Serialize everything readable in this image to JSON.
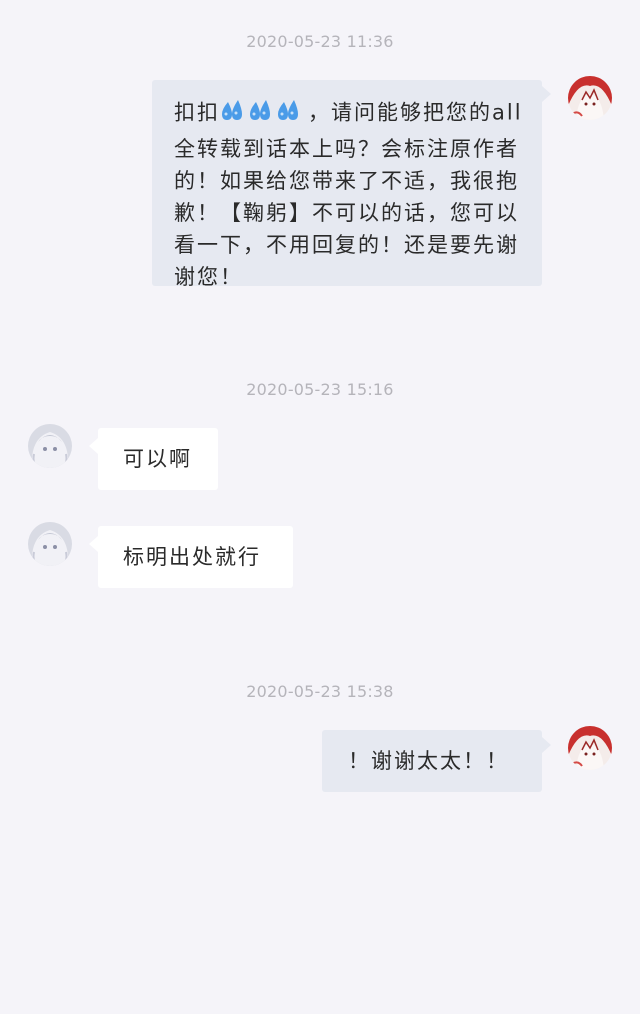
{
  "messages": [
    {
      "timestamp": "2020-05-23  11:36",
      "direction": "out",
      "text_before": "扣扣",
      "emoji": "sweat-drops",
      "text_after": "，请问能够把您的all全转载到话本上吗？会标注原作者的！如果给您带来了不适，我很抱歉！【鞠躬】不可以的话，您可以看一下，不用回复的！还是要先谢谢您！"
    },
    {
      "timestamp": "2020-05-23  15:16",
      "direction": "in",
      "text": "可以啊"
    },
    {
      "direction": "in",
      "text": "标明出处就行"
    },
    {
      "timestamp": "2020-05-23  15:38",
      "direction": "out",
      "text": "！谢谢太太！！"
    }
  ],
  "colors": {
    "background": "#f5f4f9",
    "outgoing_bubble": "#e6e9f1",
    "incoming_bubble": "#ffffff",
    "timestamp": "#b5b4ba",
    "emoji_blue": "#4a9be8"
  }
}
